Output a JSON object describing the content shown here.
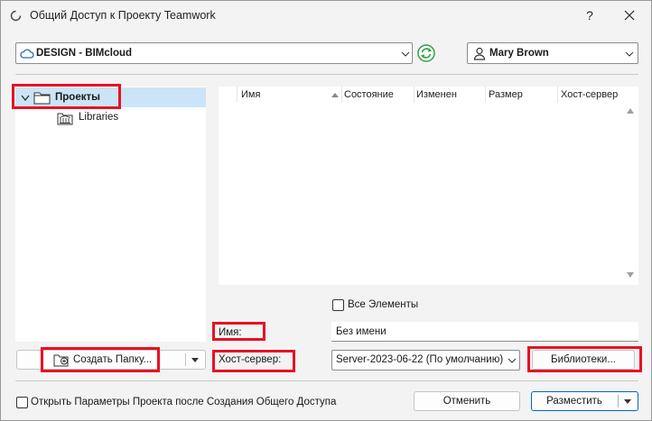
{
  "window": {
    "title": "Общий Доступ к Проекту Teamwork",
    "help_label": "?"
  },
  "server": {
    "selected": "DESIGN - BIMcloud"
  },
  "user": {
    "selected": "Mary Brown"
  },
  "tree": {
    "items": [
      {
        "label": "Проекты",
        "expanded": true,
        "selected": true
      },
      {
        "label": "Libraries"
      }
    ]
  },
  "table": {
    "columns": [
      "Имя",
      "Состояние",
      "Изменен",
      "Размер",
      "Хост-сервер"
    ],
    "sort_column": "Имя",
    "rows": []
  },
  "show_all": {
    "label": "Все Элементы",
    "checked": false
  },
  "name_field": {
    "label": "Имя:",
    "value": "Без имени"
  },
  "host_field": {
    "label": "Хост-сервер:",
    "selected": "Server-2023-06-22 (По умолчанию)"
  },
  "buttons": {
    "create_folder": "Создать Папку...",
    "libraries": "Библиотеки...",
    "cancel": "Отменить",
    "share": "Разместить"
  },
  "open_settings": {
    "label": "Открыть Параметры Проекта после Создания Общего Доступа",
    "checked": false
  },
  "colors": {
    "highlight": "#e81123",
    "selection": "#cce4f7",
    "accent": "#0067c0",
    "sync_green": "#2ea043"
  }
}
